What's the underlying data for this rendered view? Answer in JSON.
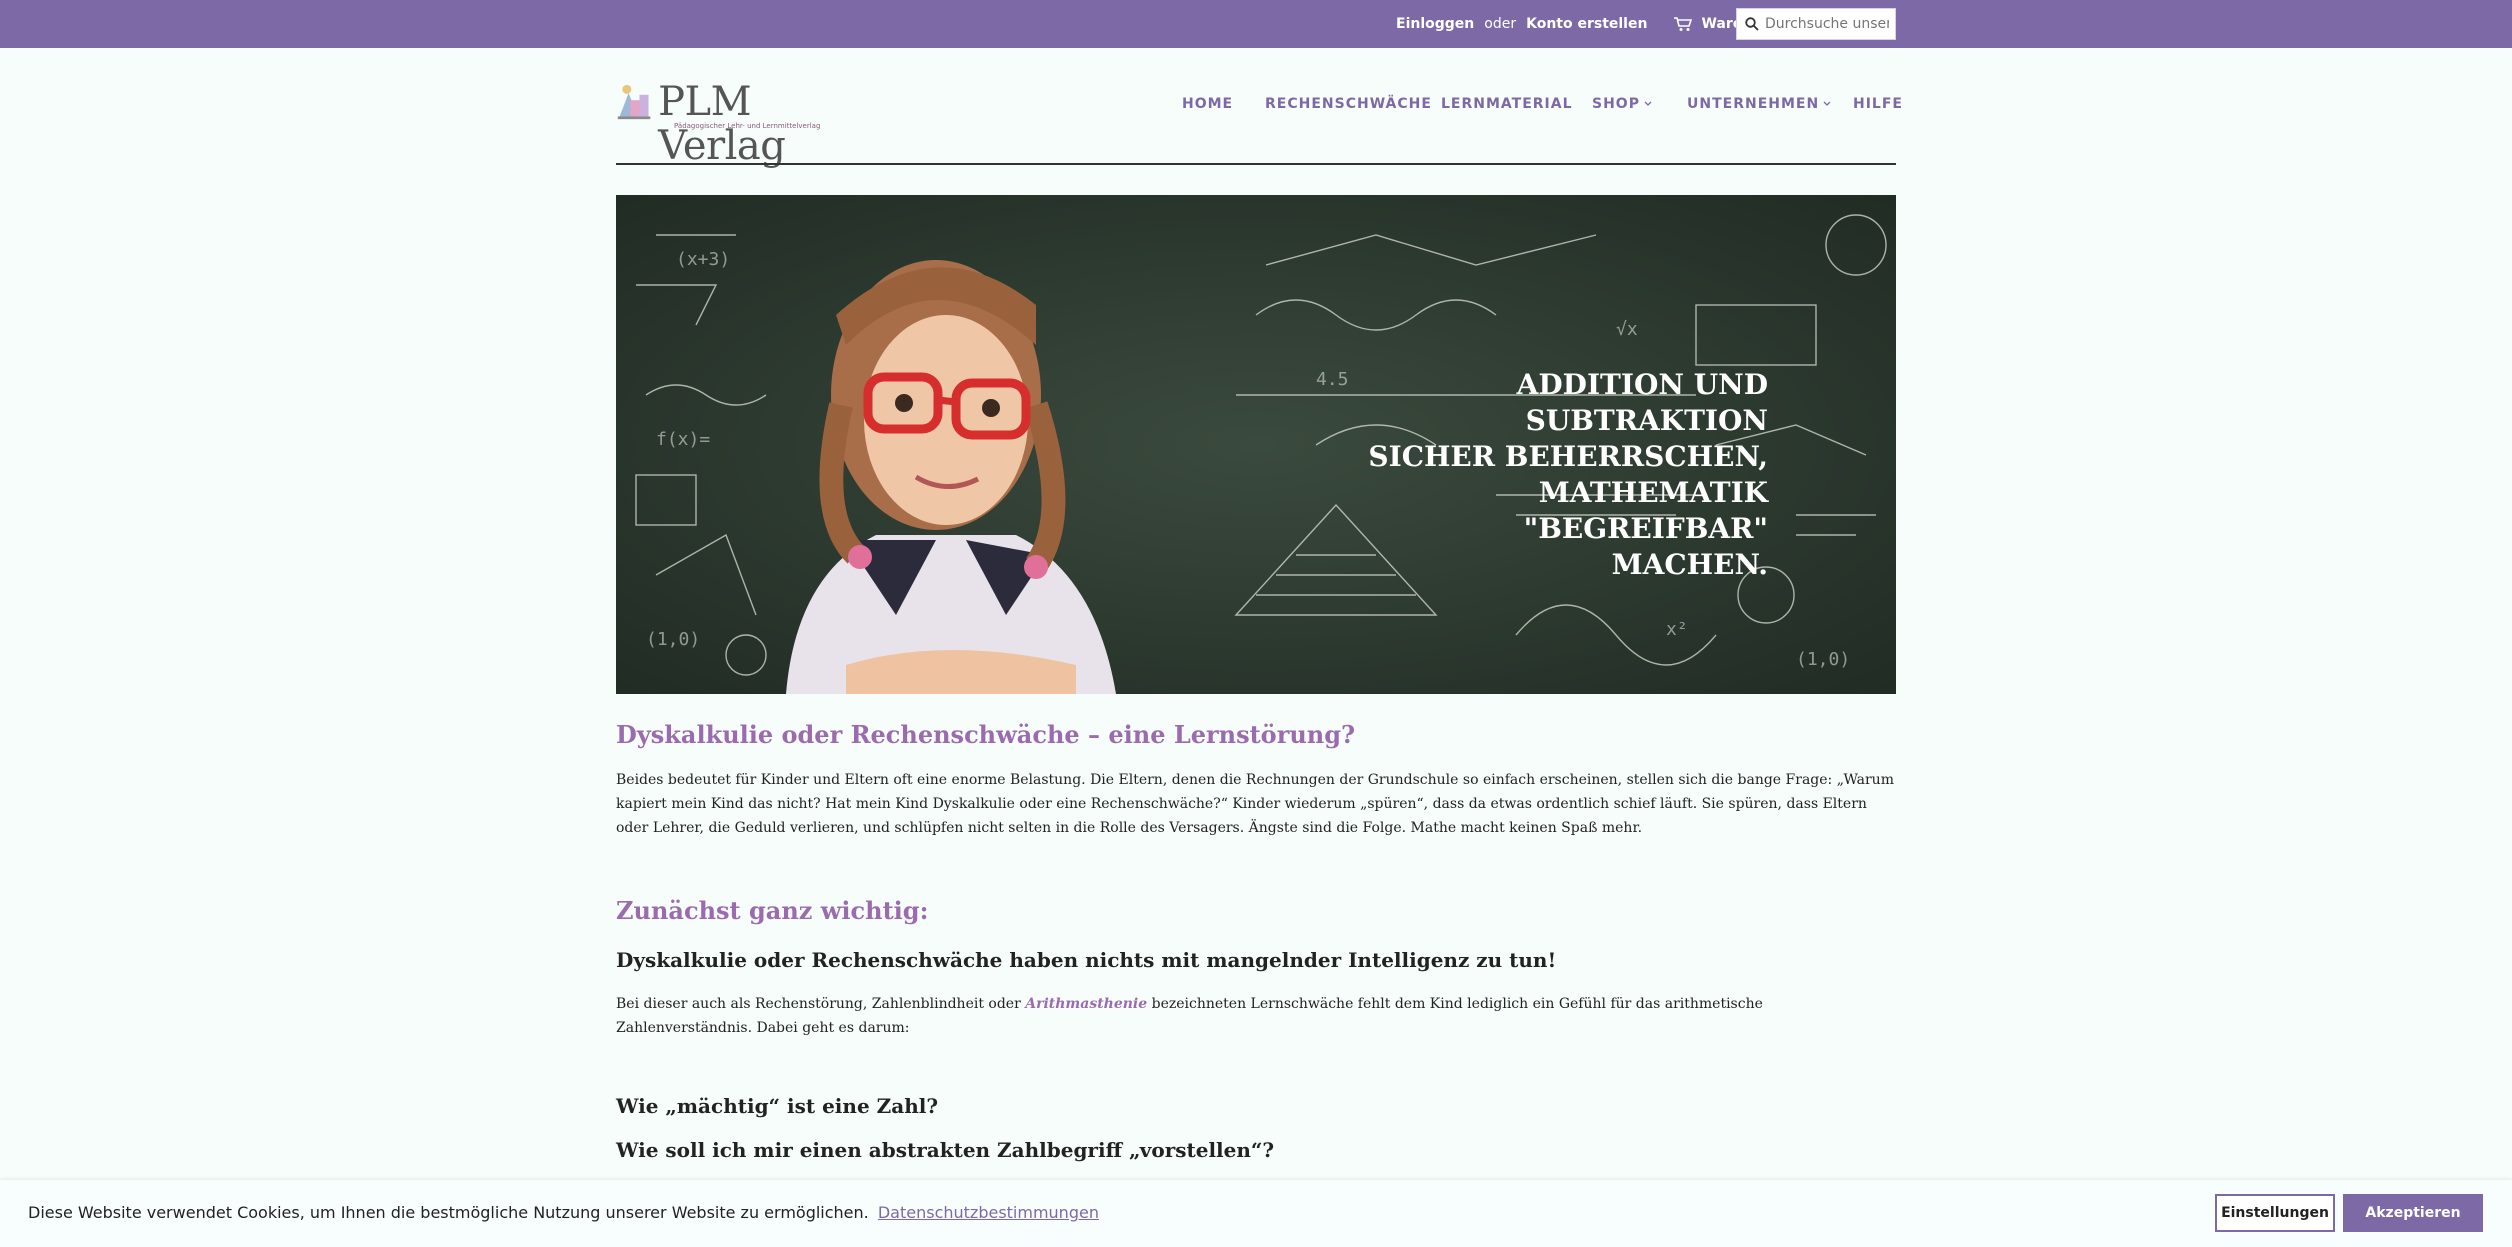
{
  "topbar": {
    "login": "Einloggen",
    "or": "oder",
    "register": "Konto erstellen",
    "cart": "Warenkorb",
    "search_placeholder": "Durchsuche unseren Shop"
  },
  "logo": {
    "name": "PLM Verlag",
    "tagline": "Pädagogischer Lehr- und Lernmittelverlag"
  },
  "nav": {
    "home": "HOME",
    "rechenschwaeche": "RECHENSCHWÄCHE",
    "lernmaterial": "LERNMATERIAL",
    "shop": "SHOP",
    "unternehmen": "UNTERNEHMEN",
    "hilfe": "HILFE"
  },
  "hero": {
    "headline": "ADDITION UND SUBTRAKTION\nSICHER BEHERRSCHEN,\nMATHEMATIK \"BEGREIFBAR\"\nMACHEN."
  },
  "content": {
    "heading1": "Dyskalkulie oder Rechenschwäche – eine Lernstörung?",
    "para1": "Beides bedeutet für Kinder und Eltern oft eine enorme Belastung. Die Eltern, denen die Rechnungen der Grundschule so einfach erscheinen, stellen sich die bange Frage: „Warum kapiert mein Kind das nicht? Hat mein Kind Dyskalkulie oder eine Rechenschwäche?“ Kinder wiederum „spüren“, dass da etwas ordentlich schief läuft. Sie spüren, dass Eltern oder Lehrer, die Geduld verlieren, und schlüpfen nicht selten in die Rolle des Versagers. Ängste sind die Folge. Mathe macht keinen Spaß mehr.",
    "heading2": "Zunächst ganz wichtig:",
    "subheading1": "Dyskalkulie oder Rechenschwäche haben nichts mit mangelnder Intelligenz zu tun!",
    "para2_before": "Bei dieser auch als Rechenstörung, Zahlenblindheit oder ",
    "para2_link": "Arithmasthenie",
    "para2_after": " bezeichneten Lernschwäche fehlt dem Kind lediglich ein Gefühl für das arithmetische Zahlenverständnis. Dabei geht es darum:",
    "q1": "Wie „mächtig“ ist eine Zahl?",
    "q2": "Wie soll ich mir einen abstrakten Zahlbegriff „vorstellen“?"
  },
  "cookie": {
    "message": "Diese Website verwendet Cookies, um Ihnen die bestmögliche Nutzung unserer Website zu ermöglichen.",
    "privacy_link": "Datenschutzbestimmungen",
    "settings_button": "Einstellungen",
    "accept_button": "Akzeptieren"
  },
  "colors": {
    "brand_purple": "#7e69a7",
    "heading_purple": "#9b6bb0",
    "page_bg": "#f6fdfb"
  }
}
